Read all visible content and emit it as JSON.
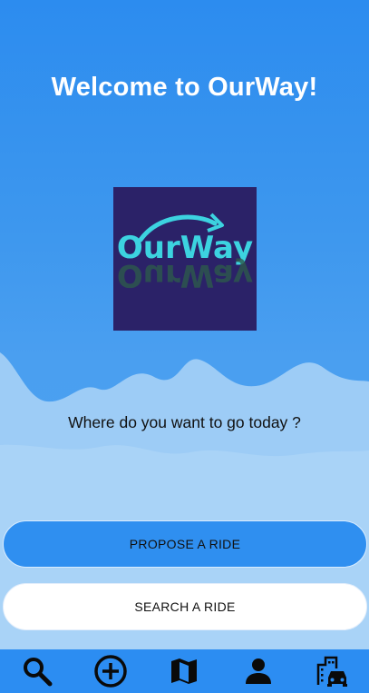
{
  "header": {
    "title": "Welcome to OurWay!"
  },
  "logo": {
    "text": "OurWay",
    "background": "#2b2268",
    "accent": "#3cd3e0"
  },
  "main": {
    "question": "Where do you want to go today ?"
  },
  "actions": {
    "propose_label": "PROPOSE A RIDE",
    "search_label": "SEARCH A RIDE"
  },
  "nav": {
    "items": [
      {
        "icon": "search-icon"
      },
      {
        "icon": "add-circle-icon"
      },
      {
        "icon": "map-icon"
      },
      {
        "icon": "person-icon"
      },
      {
        "icon": "city-car-icon"
      }
    ]
  },
  "colors": {
    "primary": "#2f8ff0",
    "wave": "#9dccf6",
    "nav_icon": "#0a0a0a"
  }
}
